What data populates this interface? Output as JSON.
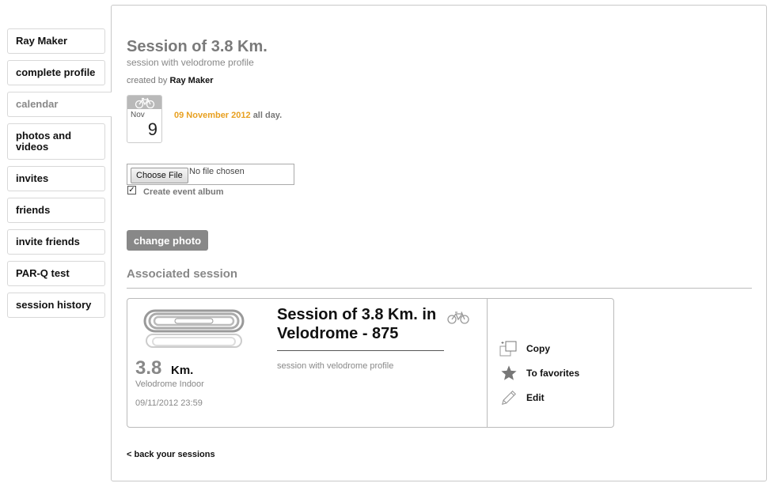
{
  "sidebar": {
    "items": [
      {
        "label": "Ray Maker"
      },
      {
        "label": "complete profile"
      },
      {
        "label": "calendar"
      },
      {
        "label": "photos and videos"
      },
      {
        "label": "invites"
      },
      {
        "label": "friends"
      },
      {
        "label": "invite friends"
      },
      {
        "label": "PAR-Q test"
      },
      {
        "label": "session history"
      }
    ]
  },
  "event": {
    "title": "Session of 3.8 Km.",
    "subtitle": "session with velodrome profile",
    "created_by_prefix": "created by",
    "created_by_name": "Ray Maker",
    "calendar_month": "Nov",
    "calendar_day": "9",
    "date": "09 November 2012",
    "all_day": "all day."
  },
  "upload": {
    "choose_file_label": "Choose File",
    "file_status": "No file chosen",
    "create_album_label": "Create event album",
    "create_album_checked": true,
    "change_photo_label": "change photo"
  },
  "associated": {
    "heading": "Associated session",
    "card": {
      "distance_value": "3.8",
      "distance_unit": "Km.",
      "location": "Velodrome Indoor",
      "datetime": "09/11/2012 23:59",
      "title": "Session of 3.8 Km. in Velodrome - 875",
      "description": "session with velodrome profile",
      "actions": [
        {
          "label": "Copy",
          "icon": "copy-icon"
        },
        {
          "label": "To favorites",
          "icon": "star-icon"
        },
        {
          "label": "Edit",
          "icon": "pencil-icon"
        }
      ]
    }
  },
  "back_link": "< back your sessions",
  "colors": {
    "accent_date": "#e8a020",
    "muted_text": "#888888",
    "button_bg": "#888888"
  }
}
